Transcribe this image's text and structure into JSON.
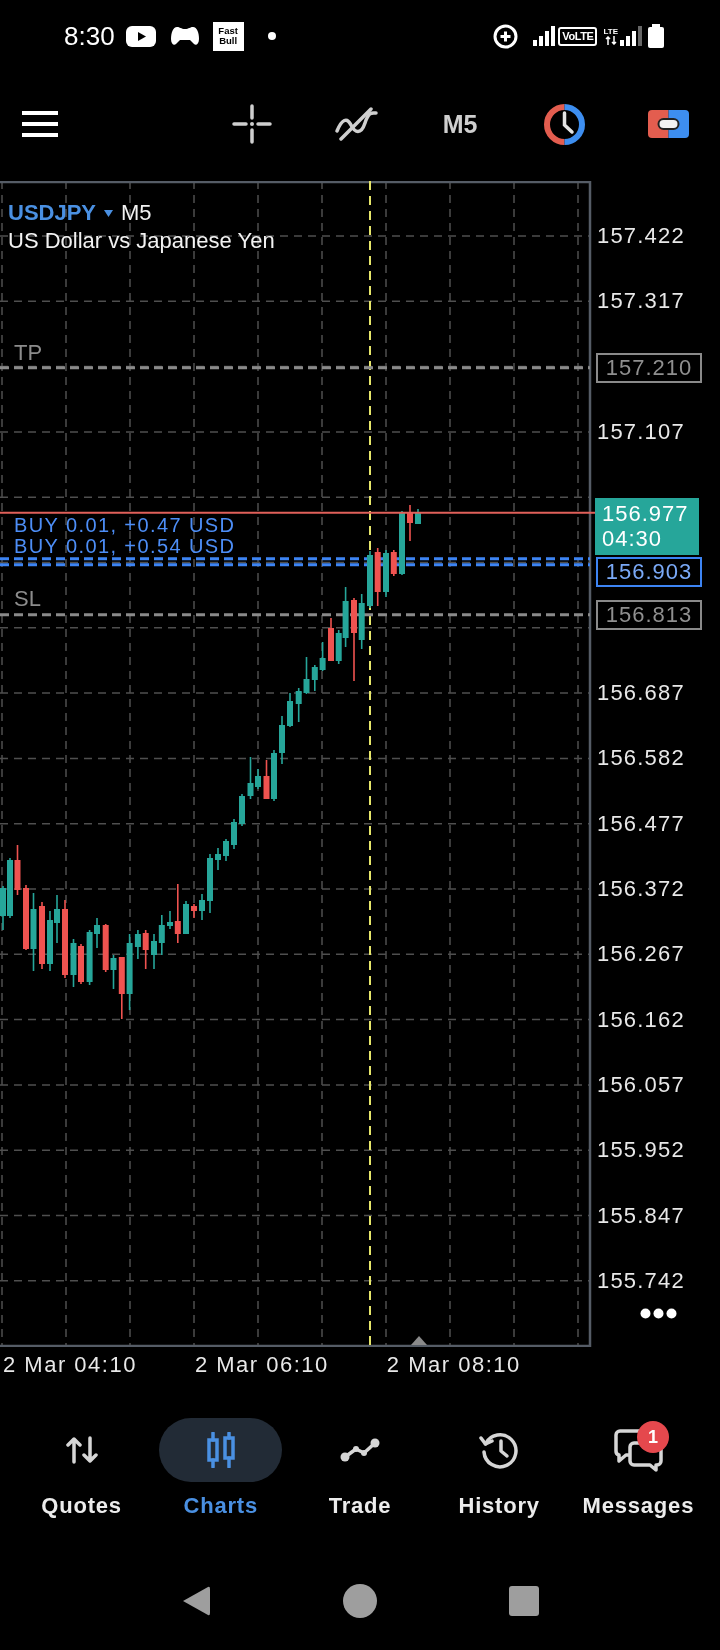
{
  "status_bar": {
    "time": "8:30",
    "app_logo_text": "Fast Bull",
    "network_badge": "VoLTE",
    "data_type": "LTE"
  },
  "toolbar": {
    "timeframe": "M5"
  },
  "chart": {
    "symbol": "USDJPY",
    "timeframe": "M5",
    "description": "US Dollar vs Japanese Yen",
    "price_axis": [
      "157.422",
      "157.317",
      "157.107",
      "156.687",
      "156.582",
      "156.477",
      "156.372",
      "156.267",
      "156.162",
      "156.057",
      "155.952",
      "155.847",
      "155.742"
    ],
    "take_profit": {
      "label": "TP",
      "price": "157.210"
    },
    "stop_loss": {
      "label": "SL",
      "price": "156.813"
    },
    "positions": [
      {
        "label": "BUY 0.01, +0.47 USD"
      },
      {
        "label": "BUY 0.01, +0.54 USD"
      }
    ],
    "position_price": "156.903",
    "current_price": {
      "price": "156.977",
      "countdown": "04:30"
    },
    "time_axis": [
      "2 Mar 04:10",
      "2 Mar 06:10",
      "2 Mar 08:10"
    ]
  },
  "bottom_nav": [
    {
      "label": "Quotes",
      "selected": false
    },
    {
      "label": "Charts",
      "selected": true
    },
    {
      "label": "Trade",
      "selected": false
    },
    {
      "label": "History",
      "selected": false
    },
    {
      "label": "Messages",
      "selected": false,
      "badge": "1"
    }
  ]
}
